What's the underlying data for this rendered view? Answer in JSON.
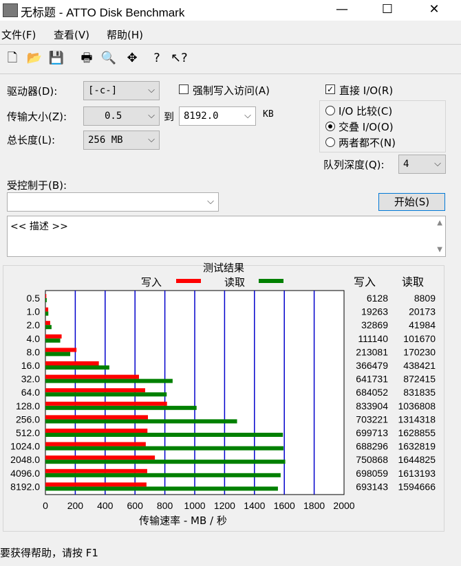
{
  "window": {
    "title": "无标题 - ATTO Disk Benchmark"
  },
  "window_buttons": {
    "minimize": "—",
    "maximize": "☐",
    "close": "✕"
  },
  "menu": [
    "文件(F)",
    "查看(V)",
    "帮助(H)"
  ],
  "toolbar_icons": [
    "new-file-icon",
    "open-folder-icon",
    "save-icon",
    "print-icon",
    "print-preview-icon",
    "move-icon",
    "help-icon",
    "context-help-icon"
  ],
  "settings": {
    "drive_label": "驱动器(D):",
    "drive_value": "[-c-]",
    "force_write_label": "强制写入访问(A)",
    "transfer_label": "传输大小(Z):",
    "transfer_from": "0.5",
    "to_label": "到",
    "transfer_to": "8192.0",
    "kb_label": "KB",
    "total_label": "总长度(L):",
    "total_value": "256 MB",
    "direct_io_label": "直接 I/O(R)",
    "io_compare_label": "I/O 比较(C)",
    "overlap_io_label": "交叠 I/O(O)",
    "neither_label": "两者都不(N)",
    "queue_label": "队列深度(Q):",
    "queue_value": "4",
    "controlled_label": "受控制于(B):",
    "controlled_value": "",
    "start_label": "开始(S)",
    "description": "<< 描述 >>"
  },
  "results": {
    "title": "测试结果",
    "legend_write": "写入",
    "legend_read": "读取",
    "col_write": "写入",
    "col_read": "读取",
    "xlabel": "传输速率 - MB / 秒",
    "write_color": "#ff0000",
    "read_color": "#008000"
  },
  "status": "要获得帮助，请按 F1",
  "chart_data": {
    "type": "bar",
    "title": "测试结果",
    "xlabel": "传输速率 - MB / 秒",
    "ylabel": "",
    "xlim": [
      0,
      2000
    ],
    "x_ticks": [
      0,
      200,
      400,
      600,
      800,
      1000,
      1200,
      1400,
      1600,
      1800,
      2000
    ],
    "categories": [
      "0.5",
      "1.0",
      "2.0",
      "4.0",
      "8.0",
      "16.0",
      "32.0",
      "64.0",
      "128.0",
      "256.0",
      "512.0",
      "1024.0",
      "2048.0",
      "4096.0",
      "8192.0"
    ],
    "series": [
      {
        "name": "写入",
        "values": [
          6128,
          19263,
          32869,
          111140,
          213081,
          366479,
          641731,
          684052,
          833904,
          703221,
          699713,
          688296,
          750868,
          698059,
          693143
        ]
      },
      {
        "name": "读取",
        "values": [
          8809,
          20173,
          41984,
          101670,
          170230,
          438421,
          872415,
          831835,
          1036808,
          1314318,
          1628855,
          1632819,
          1644825,
          1613193,
          1594666
        ]
      }
    ],
    "legend": "top",
    "grid": true
  }
}
